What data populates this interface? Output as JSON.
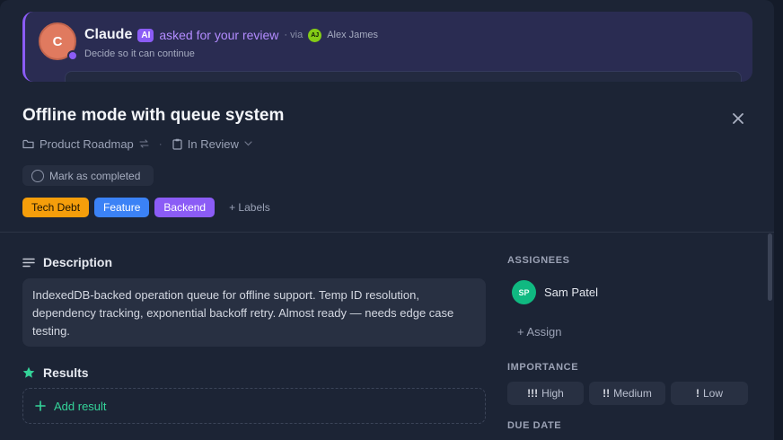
{
  "banner": {
    "avatar_initial": "C",
    "name": "Claude",
    "ai_badge": "AI",
    "action": "asked for your review",
    "via_label": "· via",
    "via_initials": "AJ",
    "via_name": "Alex James",
    "subtitle": "Decide so it can continue",
    "accent_color": "#8b5cf6"
  },
  "task": {
    "title": "Offline mode with queue system",
    "project": "Product Roadmap",
    "status": "In Review",
    "meta_separator": "·",
    "mark_complete_label": "Mark as completed",
    "labels": [
      {
        "text": "Tech Debt",
        "bg": "#f59e0b",
        "fg": "#1f1503"
      },
      {
        "text": "Feature",
        "bg": "#3b82f6",
        "fg": "#ffffff"
      },
      {
        "text": "Backend",
        "bg": "#8b5cf6",
        "fg": "#ffffff"
      }
    ],
    "add_labels": "+ Labels"
  },
  "description": {
    "heading": "Description",
    "text": "IndexedDB-backed operation queue for offline support. Temp ID resolution, dependency tracking, exponential backoff retry. Almost ready — needs edge case testing."
  },
  "results": {
    "heading": "Results",
    "add_label": "Add result"
  },
  "sidebar": {
    "assignees_label": "ASSIGNEES",
    "assignee": {
      "initials": "SP",
      "name": "Sam Patel"
    },
    "assign_link": "+ Assign",
    "importance_label": "IMPORTANCE",
    "importance": [
      {
        "marker": "!!!",
        "label": "High"
      },
      {
        "marker": "!!",
        "label": "Medium"
      },
      {
        "marker": "!",
        "label": "Low"
      }
    ],
    "due_date_label": "DUE DATE"
  }
}
